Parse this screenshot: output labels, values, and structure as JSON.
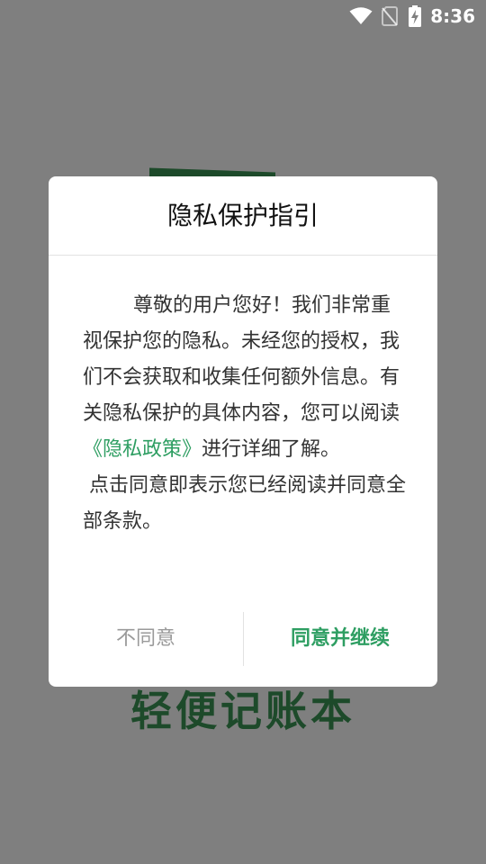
{
  "status_bar": {
    "time": "8:36",
    "icons": [
      "wifi-icon",
      "no-sim-icon",
      "battery-charging-icon"
    ]
  },
  "background": {
    "app_name": "轻便记账本"
  },
  "dialog": {
    "title": "隐私保护指引",
    "body_before_link": "        尊敬的用户您好！我们非常重视保护您的隐私。未经您的授权，我们不会获取和收集任何额外信息。有关隐私保护的具体内容，您可以阅读",
    "policy_link": "《隐私政策》",
    "body_after_link": "进行详细了解。\n 点击同意即表示您已经阅读并同意全部条款。",
    "disagree_label": "不同意",
    "agree_label": "同意并继续"
  },
  "colors": {
    "scrim": "#7f7f7f",
    "accent_green": "#2e9e62",
    "brand_dark_green": "#1d4a2a",
    "disabled_text": "#9a9a9a"
  }
}
